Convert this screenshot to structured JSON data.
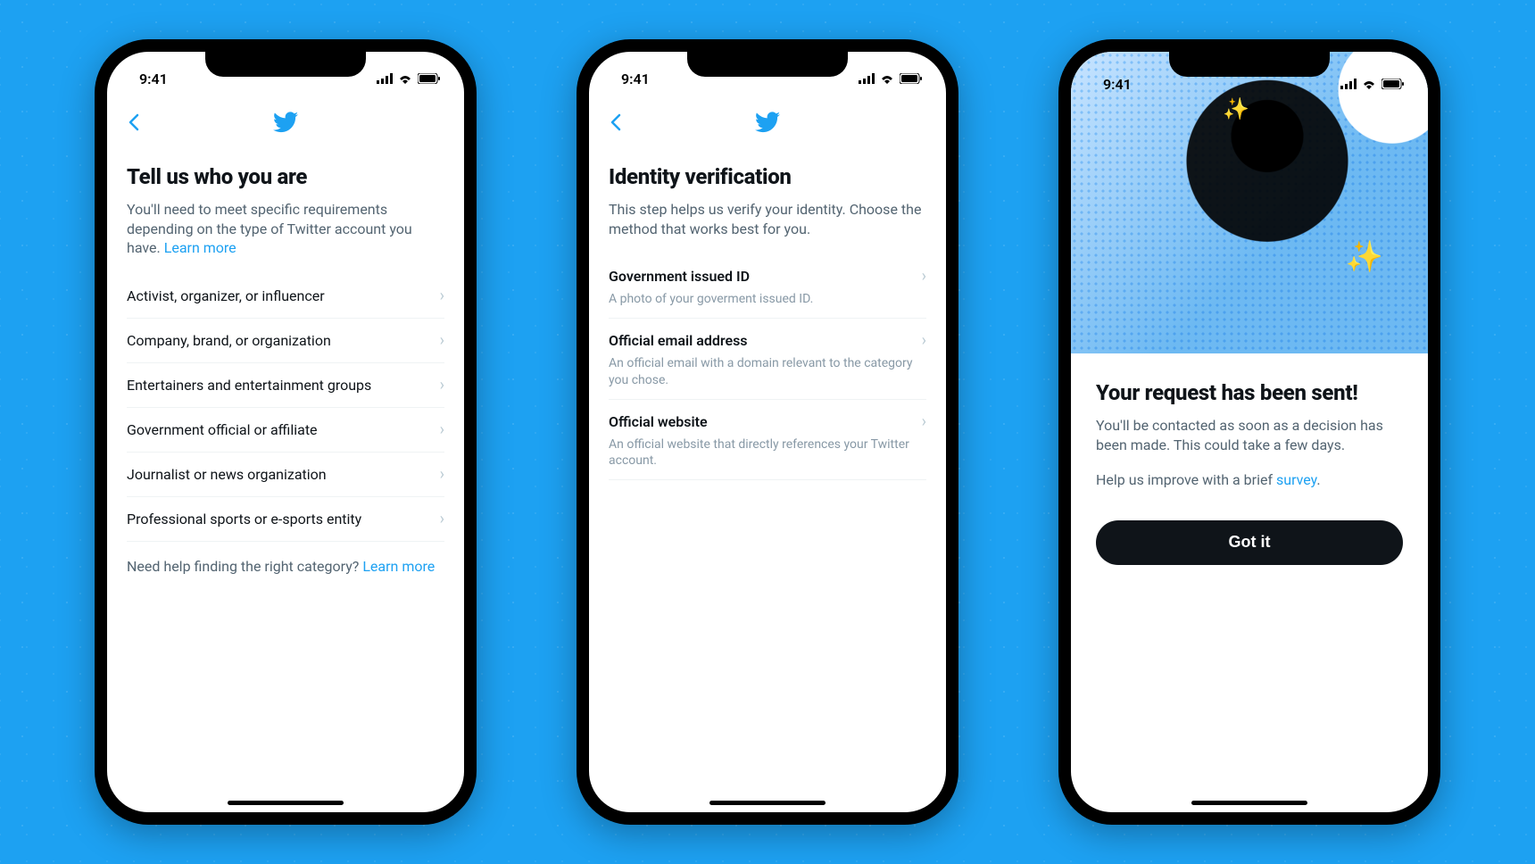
{
  "status": {
    "time": "9:41"
  },
  "colors": {
    "accent": "#1DA1F2",
    "text": "#0f1419",
    "muted": "#536471"
  },
  "screen1": {
    "title": "Tell us who you are",
    "subtitle_pre": "You'll need to meet specific requirements depending on the type of Twitter account you have. ",
    "subtitle_link": "Learn more",
    "categories": [
      "Activist, organizer, or influencer",
      "Company, brand, or organization",
      "Entertainers and entertainment groups",
      "Government official or affiliate",
      "Journalist or news organization",
      "Professional sports or e-sports entity"
    ],
    "help_pre": "Need help finding the right category? ",
    "help_link": "Learn more"
  },
  "screen2": {
    "title": "Identity verification",
    "subtitle": "This step helps us verify your identity. Choose the method that works best for you.",
    "options": [
      {
        "title": "Government issued ID",
        "sub": "A photo of your goverment issued ID."
      },
      {
        "title": "Official email address",
        "sub": "An official email with a domain relevant to the category you chose."
      },
      {
        "title": "Official website",
        "sub": "An official website that directly references your Twitter account."
      }
    ]
  },
  "screen3": {
    "title": "Your request has been sent!",
    "body": "You'll be contacted as soon as a decision has been made. This could take a few days.",
    "survey_pre": "Help us improve with a brief ",
    "survey_link": "survey",
    "survey_post": ".",
    "cta": "Got it"
  }
}
